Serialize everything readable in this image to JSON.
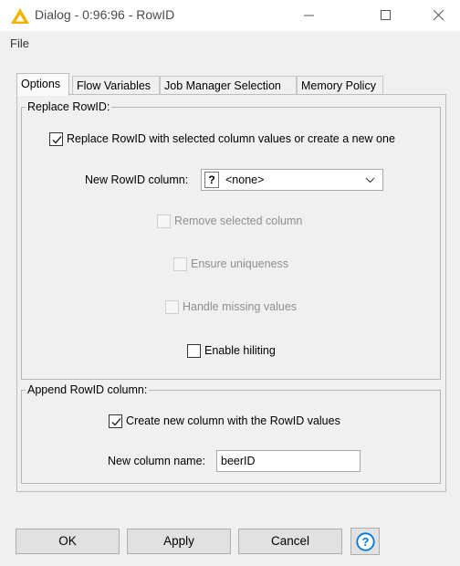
{
  "window": {
    "title": "Dialog - 0:96:96 - RowID",
    "icon": "knime-warning-triangle-icon"
  },
  "menu": {
    "file": "File"
  },
  "tabs": [
    {
      "label": "Options",
      "active": true
    },
    {
      "label": "Flow Variables",
      "active": false
    },
    {
      "label": "Job Manager Selection",
      "active": false
    },
    {
      "label": "Memory Policy",
      "active": false
    }
  ],
  "replace_group": {
    "legend": "Replace RowID:",
    "replace_checkbox": {
      "label": "Replace RowID with selected column values or create a new one",
      "checked": true
    },
    "new_rowid_column": {
      "label": "New RowID column:",
      "type_icon": "?",
      "value": "<none>"
    },
    "remove_selected": {
      "label": "Remove selected column",
      "checked": false,
      "enabled": false
    },
    "ensure_uniqueness": {
      "label": "Ensure uniqueness",
      "checked": false,
      "enabled": false
    },
    "handle_missing": {
      "label": "Handle missing values",
      "checked": false,
      "enabled": false
    },
    "enable_hiliting": {
      "label": "Enable hiliting",
      "checked": false,
      "enabled": true
    }
  },
  "append_group": {
    "legend": "Append RowID column:",
    "create_checkbox": {
      "label": "Create new column with the RowID values",
      "checked": true
    },
    "new_column_name": {
      "label": "New column name:",
      "value": "beerID"
    }
  },
  "buttons": {
    "ok": "OK",
    "apply": "Apply",
    "cancel": "Cancel"
  },
  "colors": {
    "accent": "#0078d7",
    "icon_warning": "#f2b400",
    "disabled_text": "#8f8f8f"
  }
}
